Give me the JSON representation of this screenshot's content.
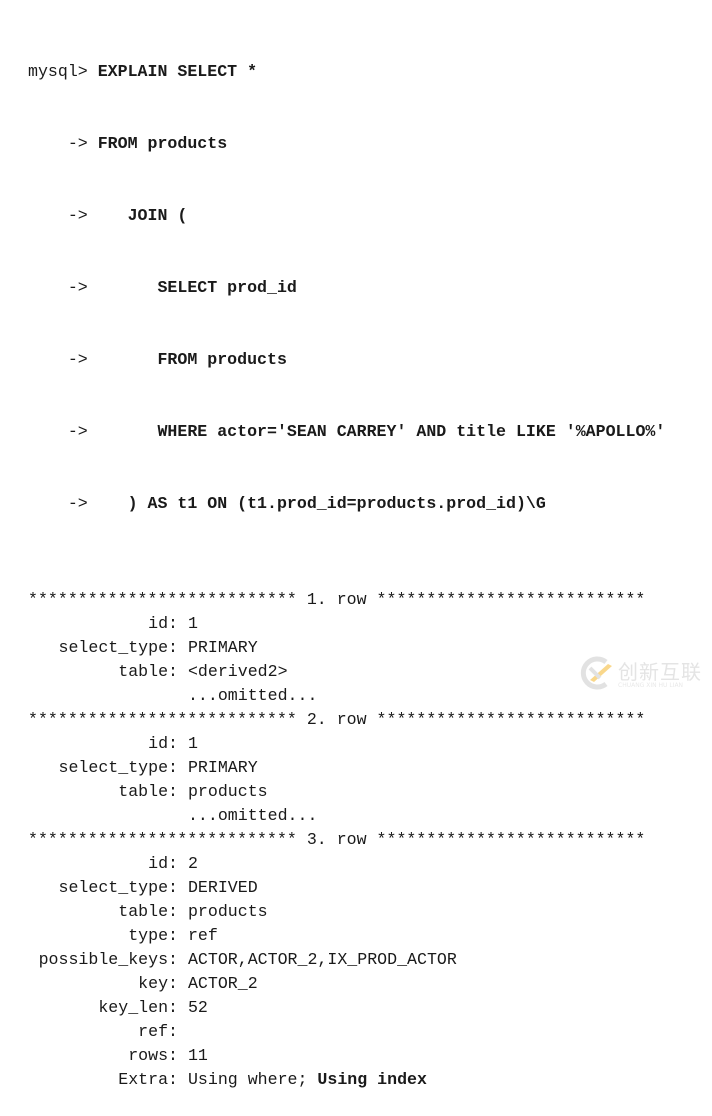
{
  "query": {
    "prompt": "mysql> ",
    "continuation_prompt": "    -> ",
    "lines": [
      "EXPLAIN SELECT *",
      "FROM products",
      "   JOIN (",
      "      SELECT prod_id",
      "      FROM products",
      "      WHERE actor='SEAN CARREY' AND title LIKE '%APOLLO%'",
      "   ) AS t1 ON (t1.prod_id=products.prod_id)\\G"
    ]
  },
  "results": [
    {
      "separator": "*************************** 1. row ***************************",
      "fields": [
        {
          "label": "id:",
          "value": "1"
        },
        {
          "label": "select_type:",
          "value": "PRIMARY"
        },
        {
          "label": "table:",
          "value": "<derived2>"
        },
        {
          "label": "",
          "value": "...omitted..."
        }
      ]
    },
    {
      "separator": "*************************** 2. row ***************************",
      "fields": [
        {
          "label": "id:",
          "value": "1"
        },
        {
          "label": "select_type:",
          "value": "PRIMARY"
        },
        {
          "label": "table:",
          "value": "products"
        },
        {
          "label": "",
          "value": "...omitted..."
        }
      ]
    },
    {
      "separator": "*************************** 3. row ***************************",
      "fields": [
        {
          "label": "id:",
          "value": "2"
        },
        {
          "label": "select_type:",
          "value": "DERIVED"
        },
        {
          "label": "table:",
          "value": "products"
        },
        {
          "label": "type:",
          "value": "ref"
        },
        {
          "label": "possible_keys:",
          "value": "ACTOR,ACTOR_2,IX_PROD_ACTOR"
        },
        {
          "label": "key:",
          "value": "ACTOR_2"
        },
        {
          "label": "key_len:",
          "value": "52"
        },
        {
          "label": "ref:",
          "value": ""
        },
        {
          "label": "rows:",
          "value": "11"
        },
        {
          "label": "Extra:",
          "value": "Using where; ",
          "value_bold": "Using index"
        }
      ]
    }
  ],
  "watermark": {
    "text": "创新互联",
    "subtext": "CHUANG XIN HU LIAN",
    "icon": "chuangxin-logo-icon",
    "accent_color": "#f5b82e",
    "gray_color": "#cccccc"
  }
}
